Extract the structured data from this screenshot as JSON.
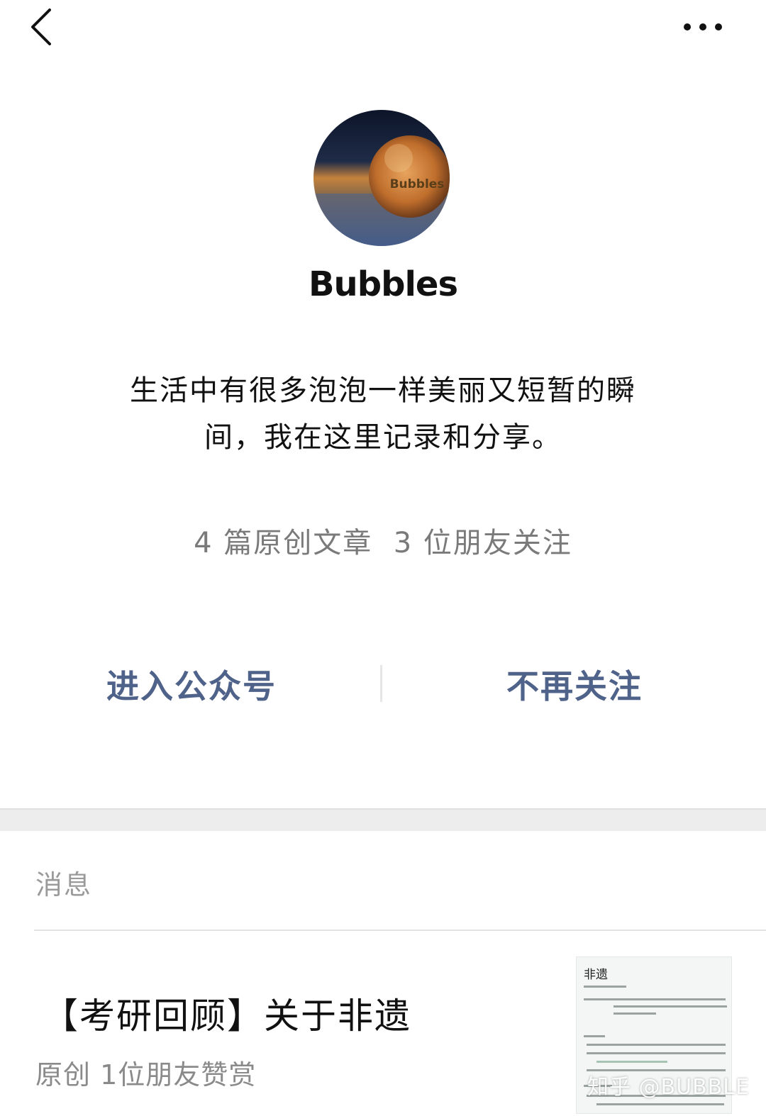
{
  "header": {
    "back_icon": "chevron-left-icon",
    "more_icon": "more-dots-icon"
  },
  "profile": {
    "avatar_label": "Bubbles",
    "name": "Bubbles",
    "bio_line1": "生活中有很多泡泡一样美丽又短暂的瞬",
    "bio_line2": "间，我在这里记录和分享。",
    "stats": "4 篇原创文章  3 位朋友关注"
  },
  "actions": {
    "enter_label": "进入公众号",
    "unfollow_label": "不再关注"
  },
  "messages": {
    "section_title": "消息",
    "items": [
      {
        "title": "【考研回顾】关于非遗",
        "meta": "原创  1位朋友赞赏",
        "thumb_title": "非遗"
      }
    ]
  },
  "watermark": "知乎 @BUBBLE",
  "colors": {
    "action_blue": "#4f6289",
    "muted_gray": "#7a7a7a",
    "band_gray": "#ededed"
  }
}
